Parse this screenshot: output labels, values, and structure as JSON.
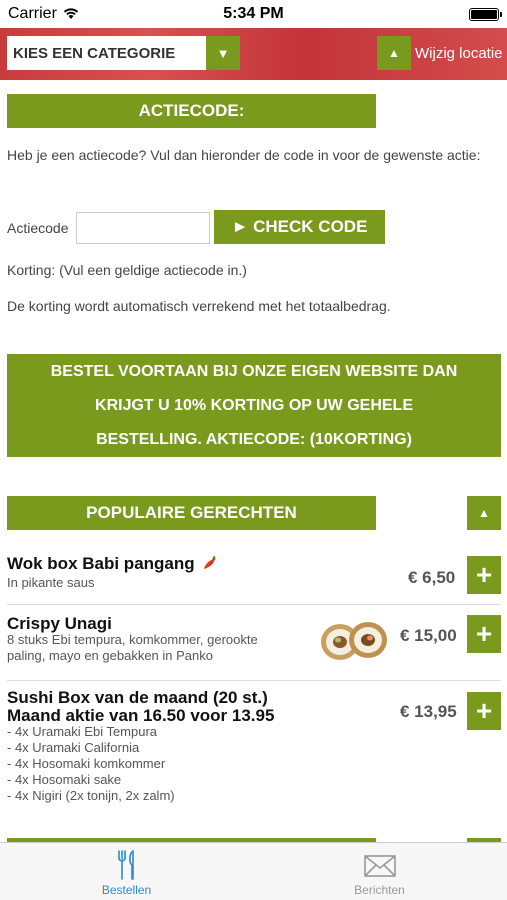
{
  "status_bar": {
    "carrier": "Carrier",
    "time": "5:34 PM"
  },
  "header": {
    "category_select": "KIES EEN CATEGORIE",
    "change_location": "Wijzig locatie"
  },
  "promo": {
    "title": "ACTIECODE:",
    "intro": "Heb je een actiecode? Vul dan hieronder de code in voor de gewenste actie:",
    "code_label": "Actiecode",
    "code_value": "",
    "check_button": "► CHECK CODE",
    "discount_status": "Korting: (Vul een geldige actiecode in.)",
    "auto_note": "De korting wordt automatisch verrekend met het totaalbedrag."
  },
  "banner": {
    "line1": "BESTEL VOORTAAN BIJ ONZE EIGEN WEBSITE DAN",
    "line2": "KRIJGT U 10% KORTING OP UW GEHELE",
    "line3": "BESTELLING. AKTIECODE: (10KORTING)"
  },
  "popular": {
    "title": "POPULAIRE GERECHTEN",
    "dishes": [
      {
        "name": "Wok box Babi pangang",
        "desc": "In pikante saus",
        "price": "€ 6,50",
        "spicy": true
      },
      {
        "name": "Crispy Unagi",
        "desc": "8 stuks Ebi tempura, komkommer, gerookte paling, mayo en gebakken in Panko",
        "price": "€ 15,00"
      },
      {
        "name_line1": "Sushi Box van de maand (20 st.)",
        "name_line2": "Maand aktie van 16.50 voor 13.95",
        "desc_lines": [
          "- 4x Uramaki Ebi Tempura",
          "- 4x Uramaki California",
          "- 4x Hosomaki komkommer",
          "- 4x Hosomaki sake",
          "- 4x Nigiri (2x tonijn, 2x zalm)"
        ],
        "price": "€ 13,95"
      }
    ]
  },
  "tabbar": {
    "tabs": [
      {
        "label": "Bestellen",
        "active": true
      },
      {
        "label": "Berichten",
        "active": false
      }
    ]
  },
  "colors": {
    "accent": "#7a9a1e",
    "header_red": "#c83c3c",
    "tab_active": "#2a8ad8",
    "tab_inactive": "#999999"
  }
}
